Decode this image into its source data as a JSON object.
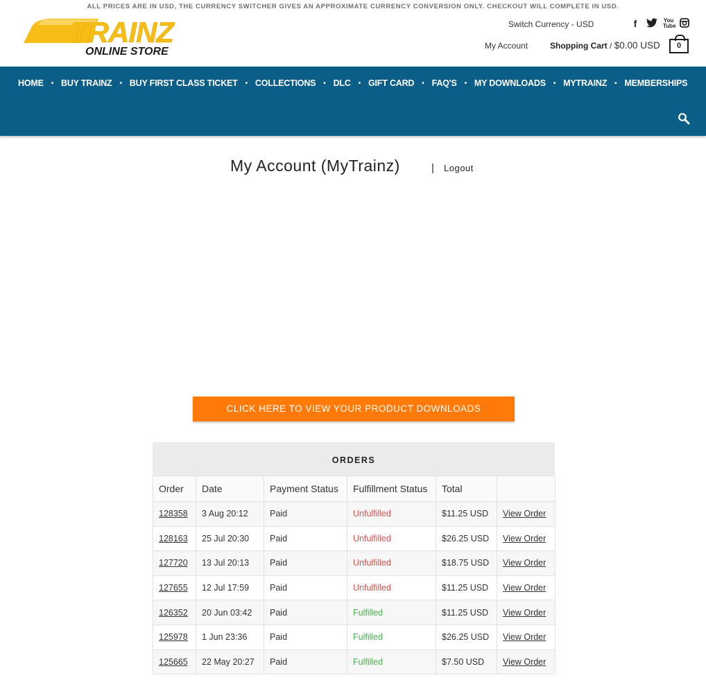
{
  "notice": "ALL PRICES ARE IN USD, THE CURRENCY SWITCHER GIVES AN APPROXIMATE CURRENCY CONVERSION ONLY. CHECKOUT WILL COMPLETE IN USD.",
  "logo": {
    "brand": "TRAINZ",
    "sub": "ONLINE STORE"
  },
  "header": {
    "switch_currency": "Switch Currency - USD",
    "my_account": "My Account",
    "cart_label": "Shopping Cart",
    "cart_sep": " / ",
    "cart_amount": "$0.00 USD",
    "cart_count": "0"
  },
  "social": {
    "facebook": "f",
    "youtube": "You Tube"
  },
  "nav": {
    "items": [
      "HOME",
      "BUY TRAINZ",
      "BUY FIRST CLASS TICKET",
      "COLLECTIONS",
      "DLC",
      "GIFT CARD",
      "FAQ'S",
      "MY DOWNLOADS",
      "MYTRAINZ",
      "MEMBERSHIPS"
    ],
    "separator": "•"
  },
  "account": {
    "title": "My Account (MyTrainz)",
    "separator": "|",
    "logout": "Logout"
  },
  "downloads_button": "CLICK HERE TO VIEW YOUR PRODUCT DOWNLOADS",
  "orders": {
    "title": "ORDERS",
    "columns": [
      "Order",
      "Date",
      "Payment Status",
      "Fulfillment Status",
      "Total",
      ""
    ],
    "rows": [
      {
        "order": "128358",
        "date": "3 Aug 20:12",
        "payment": "Paid",
        "fulfillment": "Unfulfilled",
        "total": "$11.25 USD",
        "action": "View Order"
      },
      {
        "order": "128163",
        "date": "25 Jul 20:30",
        "payment": "Paid",
        "fulfillment": "Unfulfilled",
        "total": "$26.25 USD",
        "action": "View Order"
      },
      {
        "order": "127720",
        "date": "13 Jul 20:13",
        "payment": "Paid",
        "fulfillment": "Unfulfilled",
        "total": "$18.75 USD",
        "action": "View Order"
      },
      {
        "order": "127655",
        "date": "12 Jul 17:59",
        "payment": "Paid",
        "fulfillment": "Unfulfilled",
        "total": "$11.25 USD",
        "action": "View Order"
      },
      {
        "order": "126352",
        "date": "20 Jun 03:42",
        "payment": "Paid",
        "fulfillment": "Fulfilled",
        "total": "$11.25 USD",
        "action": "View Order"
      },
      {
        "order": "125978",
        "date": "1 Jun 23:36",
        "payment": "Paid",
        "fulfillment": "Fulfilled",
        "total": "$26.25 USD",
        "action": "View Order"
      },
      {
        "order": "125665",
        "date": "22 May 20:27",
        "payment": "Paid",
        "fulfillment": "Fulfilled",
        "total": "$7.50 USD",
        "action": "View Order"
      }
    ]
  },
  "colors": {
    "nav_bg": "#0b5e88",
    "button_bg": "#ff7a08",
    "logo_yellow": "#f6bd16",
    "unfulfilled": "#d9534f",
    "fulfilled": "#4caf50"
  },
  "icons": [
    "facebook-icon",
    "twitter-icon",
    "youtube-icon",
    "instagram-icon",
    "cart-icon",
    "search-icon"
  ]
}
